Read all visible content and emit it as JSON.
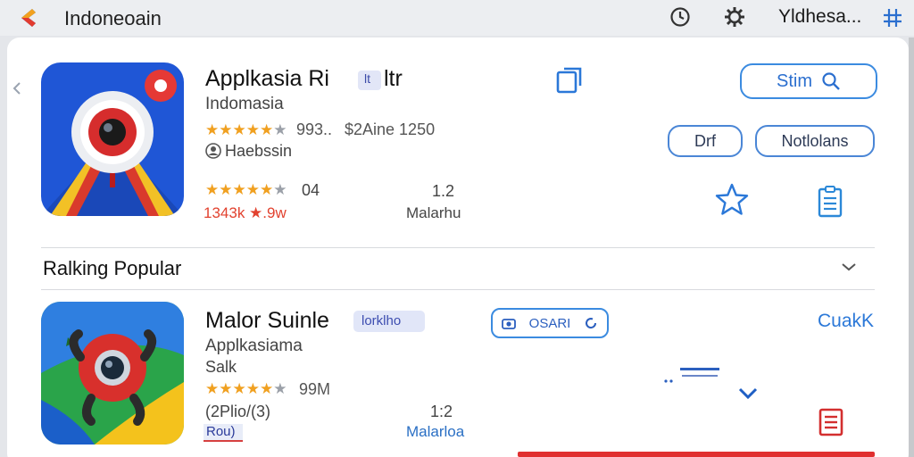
{
  "topbar": {
    "title": "Indoneoain",
    "user": "Yldhesa...",
    "icons": [
      "store-logo-icon",
      "clock-icon",
      "gear-icon",
      "grid-icon"
    ]
  },
  "featured_app": {
    "title": "Applkasia Ri",
    "badge": "lt",
    "title_tail": "ltr",
    "subtitle": "Indomasia",
    "rating_text": "993..",
    "sizes_text": "$2Aine 1250",
    "developer": "Haebssin",
    "rating2": "04",
    "red_text": "1343k ★.9w",
    "version": "1.2",
    "version_label": "Malarhu",
    "stars": 4.5,
    "stars2": 4.5,
    "buttons": {
      "primary": "Stim",
      "secondary_a": "Drf",
      "secondary_b": "Notlolans"
    }
  },
  "section": {
    "title": "Ralking Popular"
  },
  "second_app": {
    "title": "Malor Suinle",
    "badge": "lorklho",
    "subtitle": "Applkasiama",
    "subtitle2": "Salk",
    "rating_text": "99M",
    "paren": "(2Plio/(3)",
    "tag": "Rou)",
    "version": "1:2",
    "version_label": "Malarloa",
    "stars": 4.5,
    "action_button": "OSARI",
    "right_link": "CuakK"
  },
  "colors": {
    "accent": "#3b8be0",
    "star": "#f0a020",
    "alert": "#e03030"
  }
}
